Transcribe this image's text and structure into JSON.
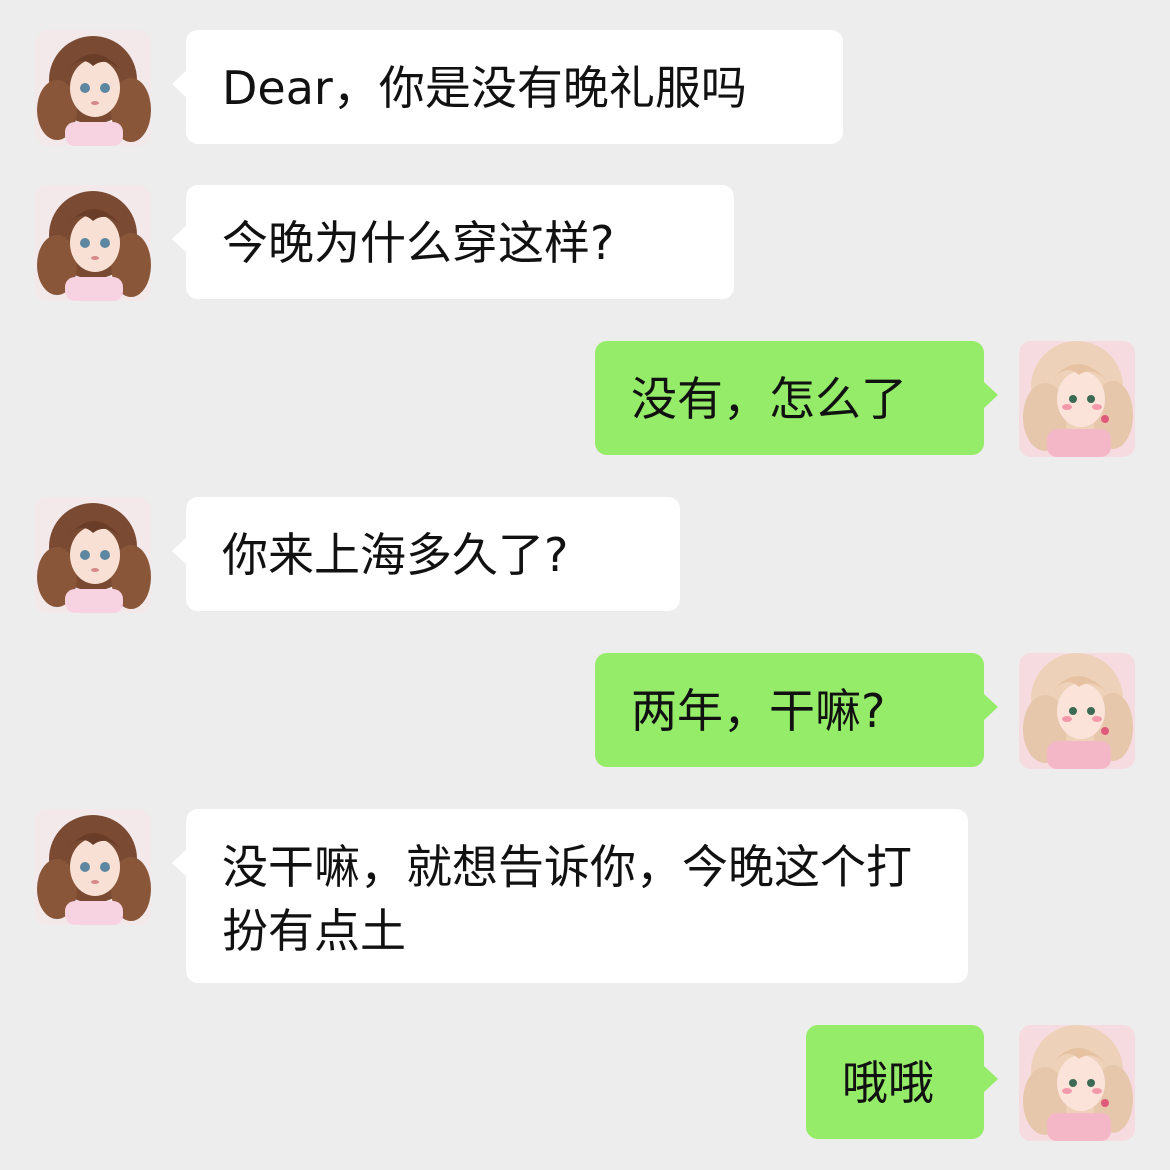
{
  "colors": {
    "background": "#ededed",
    "incoming_bubble": "#ffffff",
    "outgoing_bubble": "#95ec69",
    "text": "#111111"
  },
  "avatars": {
    "contact": "curly-brown-hair-girl-avatar",
    "self": "blonde-pink-girl-avatar"
  },
  "messages": [
    {
      "side": "in",
      "text": "Dear，你是没有晚礼服吗"
    },
    {
      "side": "in",
      "text": "今晚为什么穿这样?"
    },
    {
      "side": "out",
      "text": "没有，怎么了"
    },
    {
      "side": "in",
      "text": "你来上海多久了?"
    },
    {
      "side": "out",
      "text": "两年，干嘛?"
    },
    {
      "side": "in",
      "text": "没干嘛，就想告诉你，今晚这个打扮有点土"
    },
    {
      "side": "out",
      "text": "哦哦"
    }
  ]
}
